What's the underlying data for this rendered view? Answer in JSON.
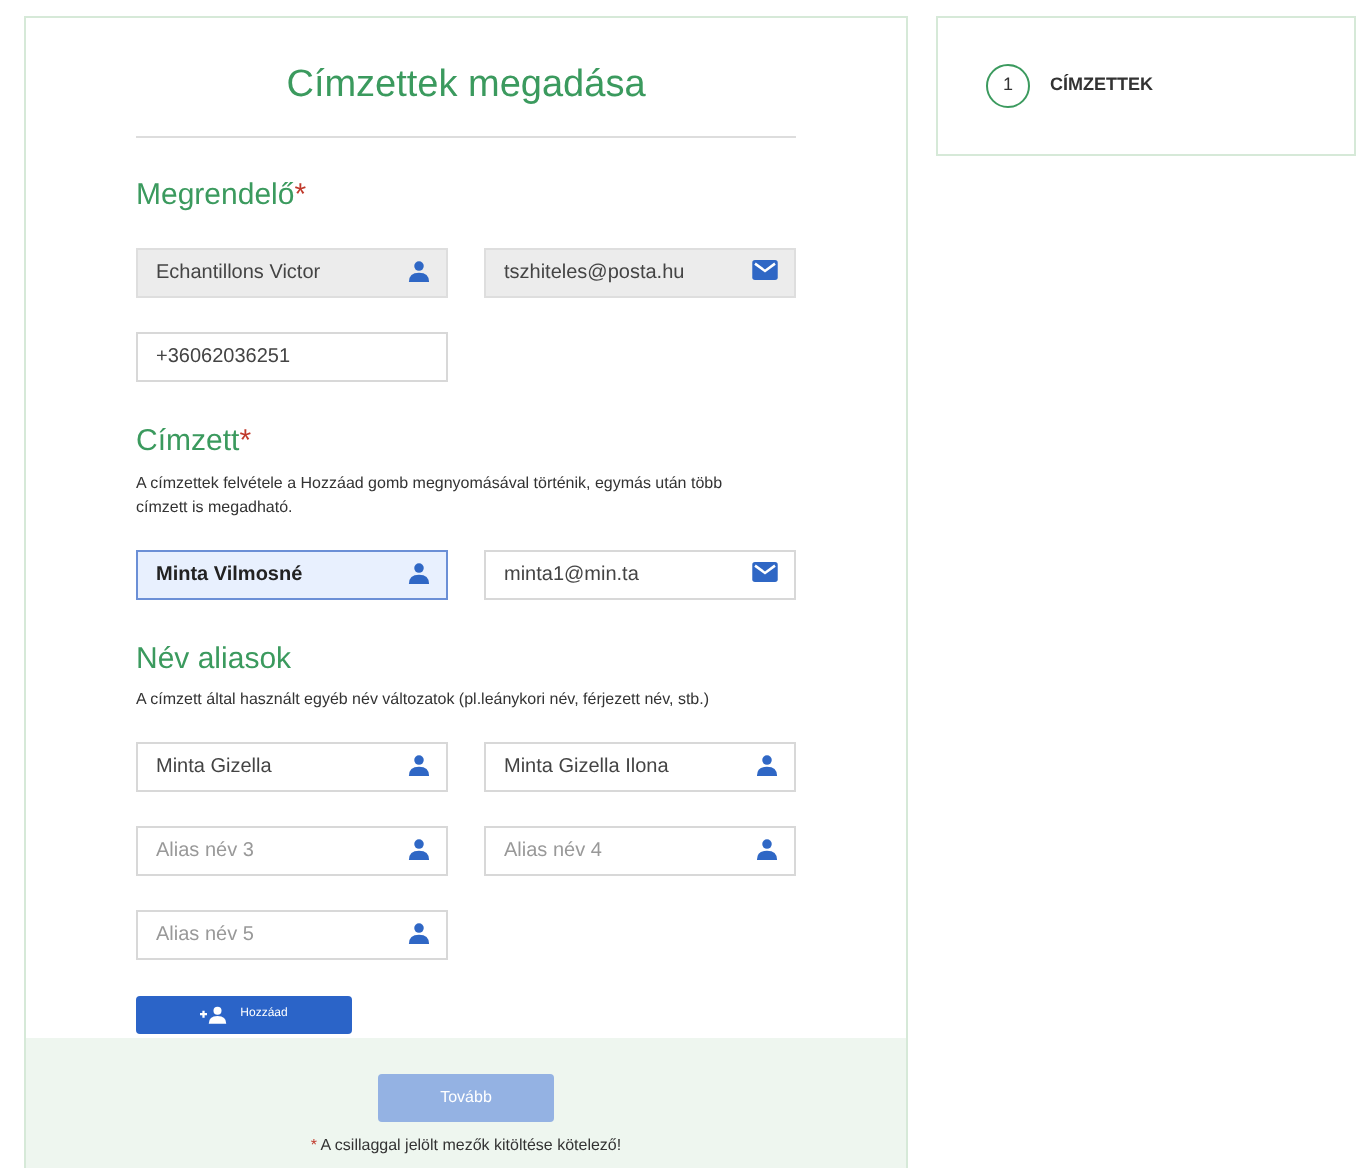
{
  "form": {
    "title": "Címzettek megadása",
    "sections": [
      {
        "heading": "Megrendelő",
        "required_mark": "*",
        "rows": [
          [
            {
              "kind": "name",
              "value": "Echantillons Victor",
              "disabled": true,
              "highlighted": false
            },
            {
              "kind": "email",
              "value": "tszhiteles@posta.hu",
              "disabled": true,
              "highlighted": false
            }
          ],
          [
            {
              "kind": "phone",
              "value": "+36062036251",
              "disabled": false,
              "highlighted": false
            }
          ]
        ]
      },
      {
        "heading": "Címzett",
        "required_mark": "*",
        "description": "A címzettek felvétele a Hozzáad gomb megnyomásával történik, egymás után több címzett is megadható.",
        "rows": [
          [
            {
              "kind": "name",
              "value": "Minta Vilmosné",
              "disabled": false,
              "highlighted": true
            },
            {
              "kind": "email",
              "value": "minta1@min.ta",
              "disabled": false,
              "highlighted": false
            }
          ]
        ]
      },
      {
        "heading": "Név aliasok",
        "description": "A címzett által használt egyéb név változatok (pl.leánykori név, férjezett név, stb.)",
        "rows": [
          [
            {
              "kind": "name",
              "value": "Minta Gizella",
              "disabled": false,
              "highlighted": false
            },
            {
              "kind": "name",
              "value": "Minta Gizella Ilona",
              "disabled": false,
              "highlighted": false
            }
          ],
          [
            {
              "kind": "name",
              "placeholder": "Alias név 3",
              "disabled": false,
              "highlighted": false
            },
            {
              "kind": "name",
              "placeholder": "Alias név 4",
              "disabled": false,
              "highlighted": false
            }
          ],
          [
            {
              "kind": "name",
              "placeholder": "Alias név 5",
              "disabled": false,
              "highlighted": false
            }
          ]
        ]
      }
    ],
    "add_button": {
      "label": "Hozzáad"
    },
    "next_button": {
      "label": "Tovább",
      "disabled": true
    },
    "footnote": {
      "mark": "*",
      "text": " A csillaggal jelölt mezők kitöltése kötelező!"
    }
  },
  "steps": [
    {
      "number": "1",
      "label": "CÍMZETTEK"
    }
  ]
}
